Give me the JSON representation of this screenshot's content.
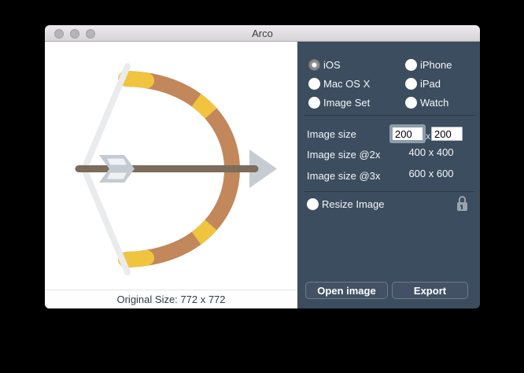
{
  "window": {
    "title": "Arco",
    "panel_color": "#3C4D5F"
  },
  "platform_options": {
    "column_left": [
      {
        "label": "iOS",
        "selected": true
      },
      {
        "label": "Mac OS X",
        "selected": false
      },
      {
        "label": "Image Set",
        "selected": false
      }
    ],
    "column_right": [
      {
        "label": "iPhone",
        "selected": false
      },
      {
        "label": "iPad",
        "selected": false
      },
      {
        "label": "Watch",
        "selected": false
      }
    ]
  },
  "size_section": {
    "image_size_label": "Image size",
    "width_value": "200",
    "separator": "x",
    "height_value": "200",
    "label_2x": "Image size @2x",
    "value_2x": "400 x 400",
    "label_3x": "Image size @3x",
    "value_3x": "600 x 600"
  },
  "resize_section": {
    "label": "Resize Image",
    "lock_icon": "locked-padlock"
  },
  "actions": {
    "open": "Open image",
    "export": "Export"
  },
  "preview": {
    "status": "Original Size: 772 x 772",
    "illustration": "bow-and-arrow",
    "colors": {
      "bow_wood": "#C2875A",
      "bow_accent": "#F1C440",
      "bowstring": "#E9EBED",
      "arrow_shaft": "#7B6C5B",
      "arrow_metal": "#C6CCD2"
    }
  }
}
